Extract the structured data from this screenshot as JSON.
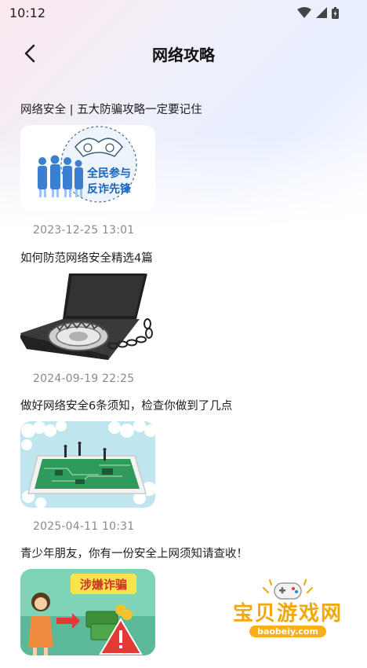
{
  "status_bar": {
    "time": "10:12"
  },
  "header": {
    "title": "网络攻略"
  },
  "articles": [
    {
      "title": "网络安全 | 五大防骗攻略一定要记住",
      "date": "2023-12-25  13:01",
      "image_text": {
        "line1": "全民参与",
        "line2": "反诈先锋"
      }
    },
    {
      "title": "如何防范网络安全精选4篇",
      "date": "2024-09-19  22:25"
    },
    {
      "title": "做好网络安全6条须知，检查你做到了几点",
      "date": "2025-04-11  10:31"
    },
    {
      "title": "青少年朋友，你有一份安全上网须知请查收！",
      "date": "",
      "image_text": {
        "banner": "涉嫌诈骗"
      }
    }
  ],
  "watermark": {
    "name": "宝贝游戏网",
    "url": "baobeiy.com"
  },
  "colors": {
    "accent": "#f3a70b",
    "date": "#8a8a8a",
    "title": "#111111"
  }
}
